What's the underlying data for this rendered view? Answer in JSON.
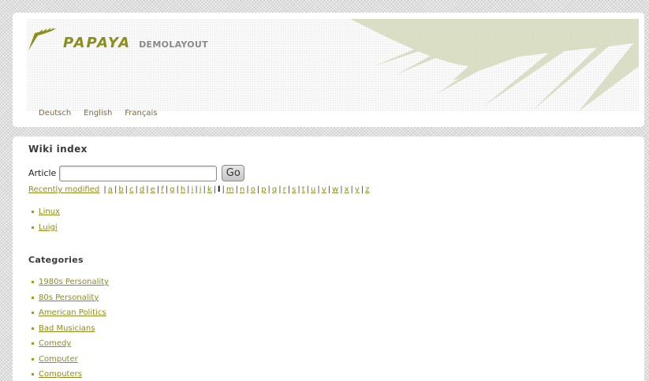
{
  "header": {
    "logo_text": "PAPAYA",
    "logo_subtitle": "DEMOLAYOUT",
    "languages": [
      "Deutsch",
      "English",
      "Français"
    ]
  },
  "main": {
    "title": "Wiki index",
    "search": {
      "label": "Article",
      "value": "",
      "go_label": "Go"
    },
    "recently_modified": "Recently modified",
    "letters": [
      "a",
      "b",
      "c",
      "d",
      "e",
      "f",
      "g",
      "h",
      "i",
      "j",
      "k",
      "l",
      "m",
      "n",
      "o",
      "p",
      "q",
      "r",
      "s",
      "t",
      "u",
      "v",
      "w",
      "x",
      "y",
      "z"
    ],
    "current_letter": "l",
    "articles": [
      "Linux",
      "Luigi"
    ],
    "categories_title": "Categories",
    "categories": [
      "1980s Personality",
      "80s Personality",
      "American Politics",
      "Bad Musicians",
      "Comedy",
      "Computer",
      "Computers"
    ]
  },
  "colors": {
    "link": "#8c8e1c",
    "logo": "#8c8e1c",
    "palm": "#d6dbc0"
  },
  "icons": [
    "papaya-logo-icon",
    "palm-leaf-decoration"
  ]
}
